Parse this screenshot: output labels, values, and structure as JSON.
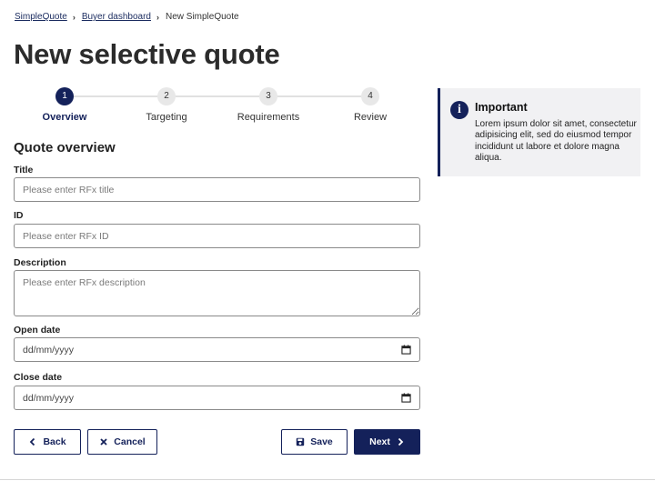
{
  "breadcrumb": {
    "items": [
      "SimpleQuote",
      "Buyer dashboard"
    ],
    "current": "New SimpleQuote"
  },
  "page": {
    "title": "New selective quote"
  },
  "stepper": {
    "steps": [
      {
        "number": "1",
        "label": "Overview"
      },
      {
        "number": "2",
        "label": "Targeting"
      },
      {
        "number": "3",
        "label": "Requirements"
      },
      {
        "number": "4",
        "label": "Review"
      }
    ],
    "active_step": 1
  },
  "form": {
    "section_title": "Quote overview",
    "title": {
      "label": "Title",
      "placeholder": "Please enter RFx title",
      "value": ""
    },
    "id": {
      "label": "ID",
      "placeholder": "Please enter RFx ID",
      "value": ""
    },
    "description": {
      "label": "Description",
      "placeholder": "Please enter RFx description",
      "value": ""
    },
    "open_date": {
      "label": "Open date",
      "placeholder": "dd/mm/yyyy"
    },
    "close_date": {
      "label": "Close date",
      "placeholder": "dd/mm/yyyy"
    }
  },
  "actions": {
    "back": "Back",
    "cancel": "Cancel",
    "save": "Save",
    "next": "Next"
  },
  "callout": {
    "icon": "info-icon",
    "heading": "Important",
    "body": "Lorem ipsum dolor sit amet, consectetur adipisicing elit, sed do eiusmod tempor incididunt ut labore et dolore magna aliqua."
  },
  "colors": {
    "brand": "#14215a",
    "callout_bg": "#f1f1f3",
    "step_inactive": "#e8e8e8"
  }
}
